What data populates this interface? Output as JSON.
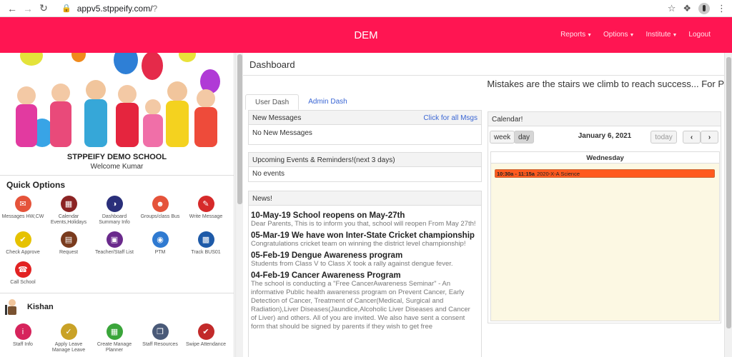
{
  "browser": {
    "url_host": "appv5.stppeify.com/",
    "url_path": "?"
  },
  "header": {
    "brand": "DEM",
    "nav": [
      {
        "label": "Reports",
        "has_caret": true
      },
      {
        "label": "Options",
        "has_caret": true
      },
      {
        "label": "Institute",
        "has_caret": true
      },
      {
        "label": "Logout",
        "has_caret": false
      }
    ]
  },
  "sidebar": {
    "school_name": "STPPEIFY DEMO SCHOOL",
    "welcome": "Welcome Kumar",
    "quick_options_title": "Quick Options",
    "quick_options": [
      {
        "label": "Messages HW,CW",
        "icon": "envelope-icon",
        "color": "#e5533a"
      },
      {
        "label": "Calendar Events,Holidays",
        "icon": "calendar-icon",
        "color": "#8b2323"
      },
      {
        "label": "Dashboard Summary Info",
        "icon": "pie-chart-icon",
        "color": "#2a2f7a"
      },
      {
        "label": "Groups/class Bus",
        "icon": "groups-icon",
        "color": "#e5533a"
      },
      {
        "label": "Write Message",
        "icon": "pencil-icon",
        "color": "#d62a2a"
      },
      {
        "label": "Check Approve",
        "icon": "thumbs-up-icon",
        "color": "#e6c200"
      },
      {
        "label": "Request",
        "icon": "briefcase-icon",
        "color": "#7a3b1e"
      },
      {
        "label": "Teacher/Staff List",
        "icon": "presentation-icon",
        "color": "#6a2a8c"
      },
      {
        "label": "PTM",
        "icon": "camera-icon",
        "color": "#2f7ad1"
      },
      {
        "label": "Track BUS01",
        "icon": "bus-icon",
        "color": "#1e5aa8"
      },
      {
        "label": "Call School",
        "icon": "phone-icon",
        "color": "#e22222"
      }
    ],
    "user_name": "Kishan",
    "staff_options": [
      {
        "label": "Staff Info",
        "icon": "info-icon",
        "color": "#d6245c"
      },
      {
        "label": "Apply Leave Manage Leave",
        "icon": "calendar-check-icon",
        "color": "#c9a227"
      },
      {
        "label": "Create Manage Planner",
        "icon": "grid-icon",
        "color": "#3aa53a"
      },
      {
        "label": "Staff Resources",
        "icon": "copy-icon",
        "color": "#4a5a78"
      },
      {
        "label": "Swipe Attendance",
        "icon": "check-calendar-icon",
        "color": "#c22a2a"
      }
    ]
  },
  "main": {
    "title": "Dashboard",
    "marquee": "Mistakes are the stairs we climb to reach success... For P",
    "tabs": [
      {
        "label": "User Dash",
        "active": true
      },
      {
        "label": "Admin Dash",
        "active": false
      }
    ],
    "messages": {
      "title": "New Messages",
      "link": "Click for all Msgs",
      "body": "No New Messages"
    },
    "events": {
      "title": "Upcoming Events & Reminders!(next 3 days)",
      "body": "No events"
    },
    "news": {
      "title": "News!",
      "items": [
        {
          "title": "10-May-19 School reopens on May-27th",
          "desc": "Dear Parents, This is to inform you that, school will reopen From May 27th!"
        },
        {
          "title": "05-Mar-19 We have won Inter-State Cricket championship",
          "desc": "Congratulations cricket team on winning the district level championship!"
        },
        {
          "title": "05-Feb-19 Dengue Awareness program",
          "desc": "Students from Class V to Class X took a rally against dengue fever."
        },
        {
          "title": "04-Feb-19 Cancer Awareness Program",
          "desc": "The school is conducting a \"Free CancerAwareness Seminar\" - An informative Public health awareness program on Prevent Cancer, Early Detection of Cancer, Treatment of Cancer(Medical, Surgical and Radiation),Liver Diseases(Jaundice,Alcoholic Liver Diseases and Cancer of Liver) and others. All of you are invited. We also have sent a consent form that should be signed by parents if they wish to get free"
        }
      ]
    },
    "calendar": {
      "title": "Calendar!",
      "week_label": "week",
      "day_label": "day",
      "date": "January 6, 2021",
      "today_label": "today",
      "prev_label": "‹",
      "next_label": "›",
      "day_name": "Wednesday",
      "event_time": "10:30a - 11:15a",
      "event_title": "2020-X-A Science",
      "event_color": "#ff5a1e"
    }
  }
}
